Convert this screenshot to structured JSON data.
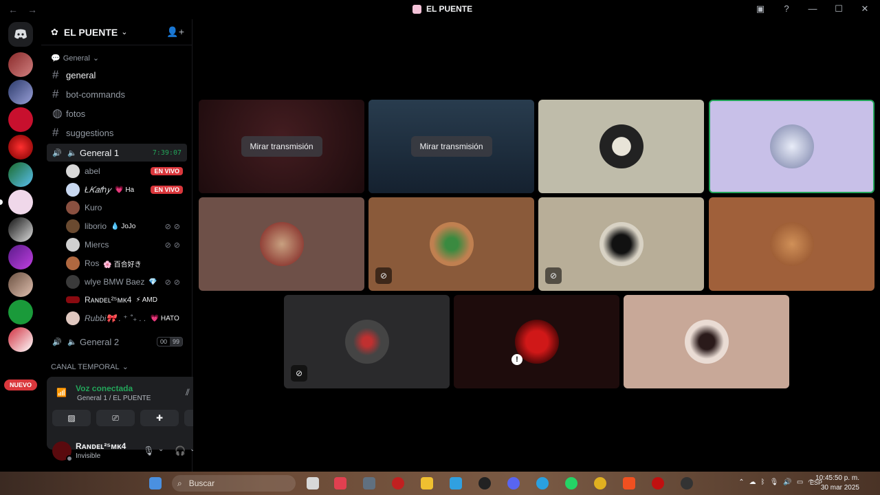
{
  "window": {
    "title": "EL PUENTE",
    "nav_back": "←",
    "nav_forward": "→",
    "inbox_icon": "▣",
    "help_icon": "?",
    "minimize": "—",
    "maximize": "☐",
    "close": "✕"
  },
  "guilds": {
    "home_label": "◉",
    "nuevo_badge": "NUEVO"
  },
  "server": {
    "name": "EL PUENTE",
    "chevron": "⌄",
    "invite_icon": "👤+"
  },
  "channels": {
    "category_general": "General",
    "text": [
      {
        "name": "general"
      },
      {
        "name": "bot-commands"
      },
      {
        "name": "fotos"
      },
      {
        "name": "suggestions"
      }
    ],
    "voice_active": {
      "name": "General 1",
      "timer": "7:39:07"
    },
    "voice_users": [
      {
        "name": "abel",
        "extra": "",
        "badge": "EN VIVO"
      },
      {
        "name": "Ł𝐾𝑎𝑡ℎ𝑦",
        "extra": "💗 Ha",
        "badge": "EN VIVO"
      },
      {
        "name": "Kuro",
        "extra": "",
        "badge": ""
      },
      {
        "name": "liborio",
        "extra": "💧 JoJo",
        "badge": ""
      },
      {
        "name": "Miercs",
        "extra": "",
        "badge": ""
      },
      {
        "name": "Ros",
        "extra": "🌸 百合好き",
        "badge": ""
      },
      {
        "name": "wlye BMW Baez",
        "extra": "💎",
        "badge": ""
      },
      {
        "name": "Rᴀɴᴅᴇʟ²⁵ᴍᴋ4",
        "extra": "⚡ AMD",
        "badge": ""
      },
      {
        "name": "Rubbi🎀 . ⁺ ˚₊ . .",
        "extra": "💗 HATO",
        "badge": ""
      }
    ],
    "voice_second": {
      "name": "General 2",
      "count_left": "00",
      "count_right": "99"
    },
    "category_temporal": "CANAL TEMPORAL"
  },
  "voice_panel": {
    "status": "Voz conectada",
    "location": "General 1 / EL PUENTE"
  },
  "user_panel": {
    "name": "Rᴀɴᴅᴇʟ²⁵ᴍᴋ4",
    "status": "Invisible"
  },
  "stage": {
    "watch_label_1": "Mirar transmisión",
    "watch_label_2": "Mirar transmisión"
  },
  "taskbar": {
    "search_placeholder": "Buscar",
    "lang": "ESP",
    "time": "10:45:50 p. m.",
    "date": "30 mar 2025"
  },
  "colors": {
    "accent_green": "#23a55a",
    "live_red": "#da373c",
    "background": "#000000"
  }
}
